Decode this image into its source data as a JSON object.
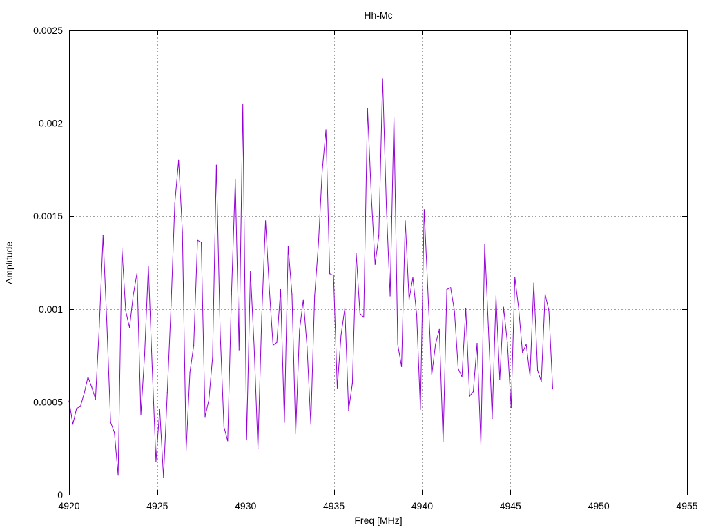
{
  "chart_data": {
    "type": "line",
    "title": "Hh-Mc",
    "xlabel": "Freq [MHz]",
    "ylabel": "Amplitude",
    "xlim": [
      4920,
      4955
    ],
    "ylim": [
      0,
      0.0025
    ],
    "xticks": [
      4920,
      4925,
      4930,
      4935,
      4940,
      4945,
      4950,
      4955
    ],
    "yticks": [
      0,
      0.0005,
      0.001,
      0.0015,
      0.002,
      0.0025
    ],
    "xtick_labels": [
      "4920",
      "4925",
      "4930",
      "4935",
      "4940",
      "4945",
      "4950",
      "4955"
    ],
    "ytick_labels": [
      "0",
      "0.0005",
      "0.001",
      "0.0015",
      "0.002",
      "0.0025"
    ],
    "grid": true,
    "legend": "none",
    "series_color": "#9400d3",
    "grid_color": "#a0a0a0",
    "x_start": 4920,
    "x_step": 0.214,
    "y": [
      0.000505,
      0.00038,
      0.000465,
      0.000475,
      0.000545,
      0.000635,
      0.00058,
      0.000515,
      0.000905,
      0.001395,
      0.00093,
      0.00039,
      0.000335,
      0.000105,
      0.001325,
      0.00099,
      0.0009,
      0.001075,
      0.001195,
      0.00043,
      0.00075,
      0.00123,
      0.00069,
      0.00018,
      0.00046,
      9.5e-05,
      0.00055,
      0.00102,
      0.00157,
      0.0018,
      0.001415,
      0.00024,
      0.00066,
      0.000805,
      0.00137,
      0.00136,
      0.00042,
      0.00051,
      0.00074,
      0.001775,
      0.000875,
      0.000365,
      0.00029,
      0.00108,
      0.001695,
      0.00078,
      0.0021,
      0.0003,
      0.001205,
      0.0008,
      0.00025,
      0.00096,
      0.001475,
      0.001115,
      0.000805,
      0.00082,
      0.001105,
      0.00039,
      0.001335,
      0.00108,
      0.00033,
      0.000885,
      0.00105,
      0.000795,
      0.00038,
      0.00107,
      0.00135,
      0.00174,
      0.001965,
      0.00119,
      0.00118,
      0.000575,
      0.00086,
      0.001005,
      0.000455,
      0.0006,
      0.0013,
      0.000975,
      0.000955,
      0.00208,
      0.00161,
      0.00124,
      0.001395,
      0.00224,
      0.001545,
      0.00107,
      0.002035,
      0.00081,
      0.00069,
      0.001475,
      0.00105,
      0.00117,
      0.00097,
      0.00046,
      0.001535,
      0.001085,
      0.000645,
      0.00081,
      0.00089,
      0.000285,
      0.001105,
      0.001115,
      0.00099,
      0.00068,
      0.000635,
      0.001005,
      0.00053,
      0.000555,
      0.000815,
      0.00027,
      0.00135,
      0.0009,
      0.00041,
      0.00107,
      0.00062,
      0.00101,
      0.00082,
      0.00047,
      0.00117,
      0.001005,
      0.000765,
      0.00081,
      0.00064,
      0.00114,
      0.00067,
      0.00061,
      0.00108,
      0.00099,
      0.00057
    ]
  }
}
